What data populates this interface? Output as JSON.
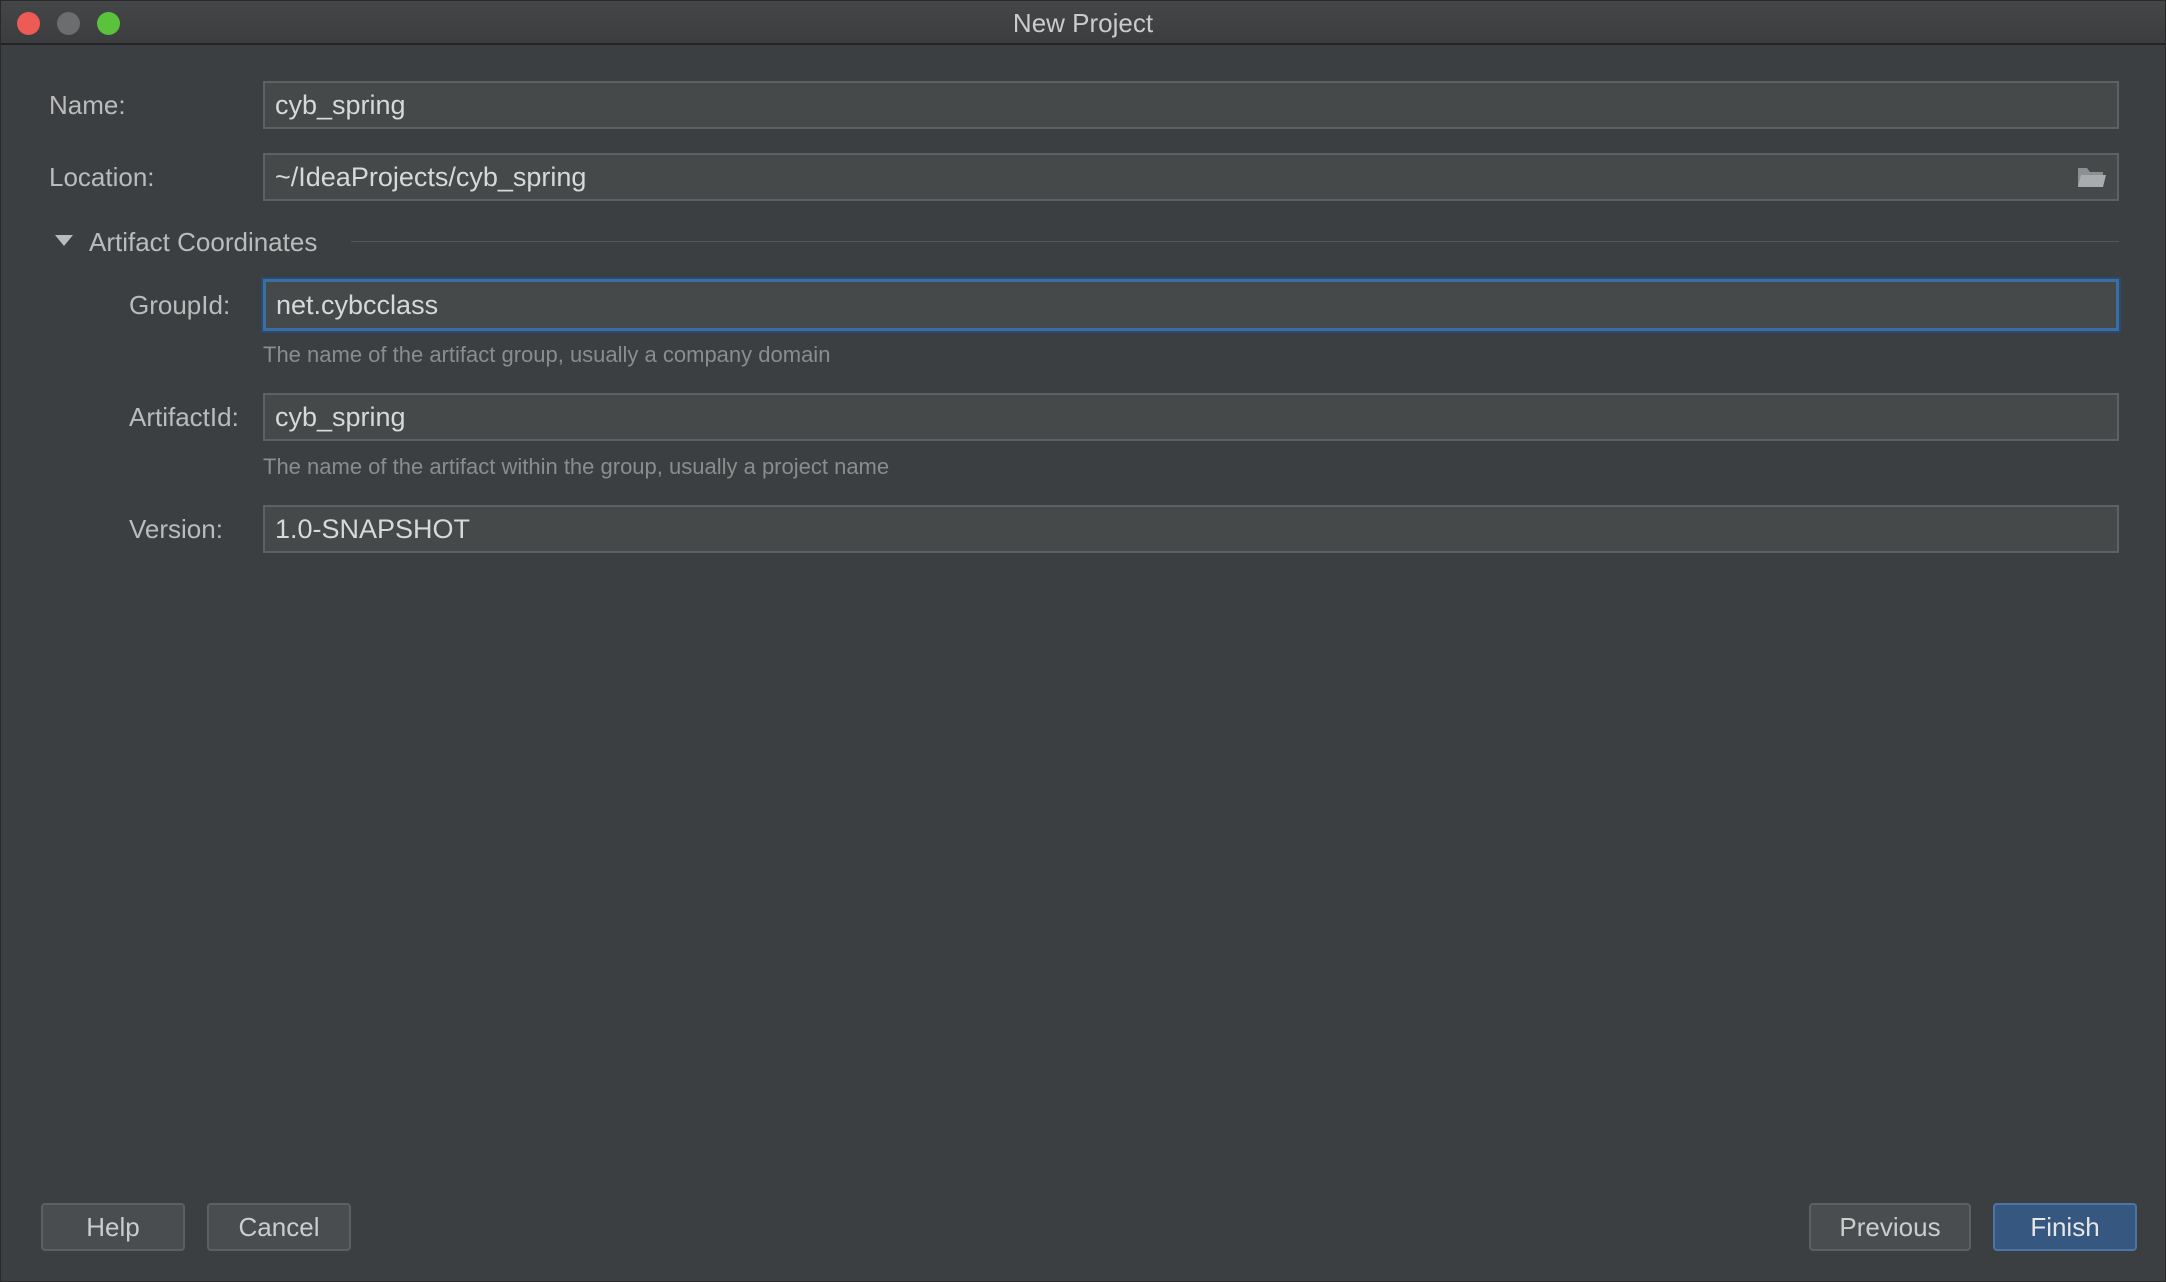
{
  "window": {
    "title": "New Project"
  },
  "form": {
    "name": {
      "label": "Name:",
      "value": "cyb_spring"
    },
    "location": {
      "label": "Location:",
      "value": "~/IdeaProjects/cyb_spring"
    },
    "artifact_section": {
      "label": "Artifact Coordinates",
      "expanded": true
    },
    "group_id": {
      "label": "GroupId:",
      "value": "net.cybcclass",
      "hint": "The name of the artifact group, usually a company domain"
    },
    "artifact_id": {
      "label": "ArtifactId:",
      "value": "cyb_spring",
      "hint": "The name of the artifact within the group, usually a project name"
    },
    "version": {
      "label": "Version:",
      "value": "1.0-SNAPSHOT"
    }
  },
  "buttons": {
    "help": "Help",
    "cancel": "Cancel",
    "previous": "Previous",
    "finish": "Finish"
  },
  "icons": {
    "close": "close-icon",
    "minimize": "minimize-icon",
    "maximize": "maximize-icon",
    "folder": "folder-icon",
    "disclosure": "chevron-down-icon"
  },
  "colors": {
    "background": "#3c3f41",
    "field": "#45494a",
    "focus": "#3d6ea3",
    "primary_button": "#365880",
    "close": "#ee5b57",
    "maximize": "#5bc23d"
  }
}
